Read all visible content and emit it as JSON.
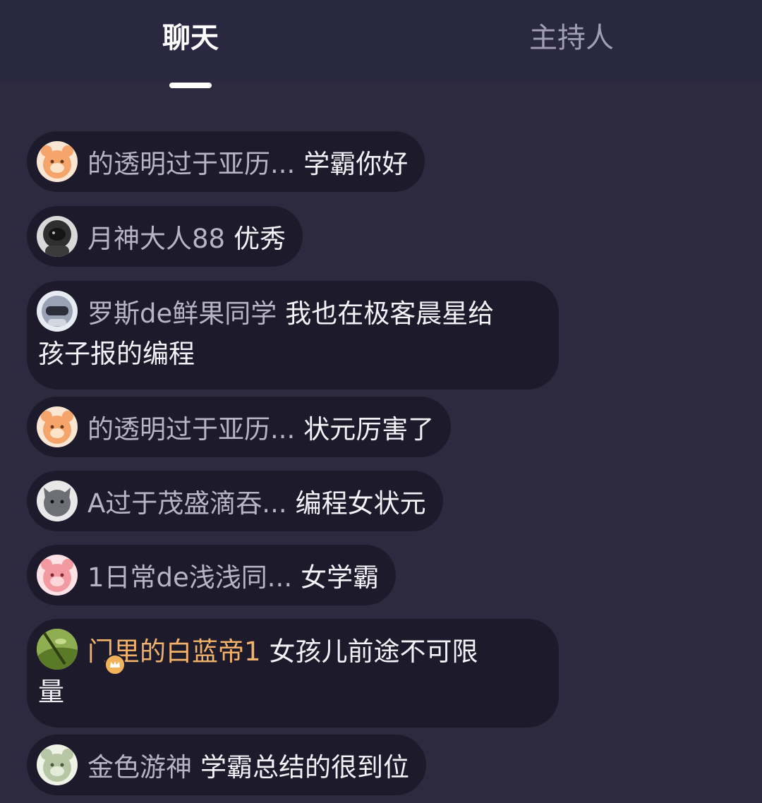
{
  "tabs": [
    {
      "label": "聊天",
      "active": true
    },
    {
      "label": "主持人",
      "active": false
    }
  ],
  "messages": [
    {
      "user": "的透明过于亚历...",
      "text": "学霸你好",
      "avatar": "orange-bear-avatar",
      "avatar_color": "#f5a46b"
    },
    {
      "user": "月神大人88",
      "text": "优秀",
      "avatar": "dark-astronaut-avatar",
      "avatar_color": "#3a3a3a"
    },
    {
      "user": "罗斯de鲜果同学",
      "text": "我也在极客晨星给",
      "text_cont": "孩子报的编程",
      "avatar": "helmet-avatar",
      "avatar_color": "#9aa3b5"
    },
    {
      "user": "的透明过于亚历...",
      "text": "状元厉害了",
      "avatar": "orange-bear-avatar",
      "avatar_color": "#f5a46b"
    },
    {
      "user": "A过于茂盛滴吞...",
      "text": "编程女状元",
      "avatar": "gray-cat-avatar",
      "avatar_color": "#6d6f74"
    },
    {
      "user": "1日常de浅浅同...",
      "text": "女学霸",
      "avatar": "pink-bear-avatar",
      "avatar_color": "#f29aa0"
    },
    {
      "user": "门里的白蓝帝1",
      "text": "女孩儿前途不可限",
      "text_cont": "量",
      "avatar": "nature-photo-avatar",
      "avatar_color": "#6f8a3a",
      "vip": true
    },
    {
      "user": "金色游神",
      "text": "学霸总结的很到位",
      "avatar": "green-bear-avatar",
      "avatar_color": "#b7c7a6"
    }
  ]
}
